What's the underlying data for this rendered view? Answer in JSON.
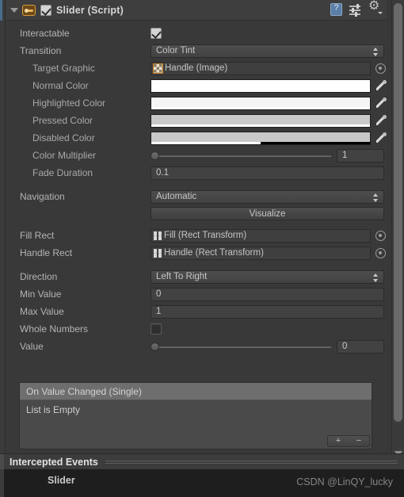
{
  "component": {
    "title": "Slider (Script)",
    "enabled_checkbox": "checked",
    "icons": {
      "foldout": "foldout-triangle-icon",
      "component": "slider-component-icon",
      "help": "help-book-icon",
      "preset": "preset-sliders-icon",
      "settings": "gear-dropdown-icon"
    }
  },
  "properties": {
    "interactable": {
      "label": "Interactable",
      "value": "checked"
    },
    "transition": {
      "label": "Transition",
      "value": "Color Tint"
    },
    "target_graphic": {
      "label": "Target Graphic",
      "value": "Handle (Image)"
    },
    "normal_color": {
      "label": "Normal Color",
      "hex": "#FFFFFF",
      "alpha": 100
    },
    "highlighted_color": {
      "label": "Highlighted Color",
      "hex": "#F5F5F5",
      "alpha": 100
    },
    "pressed_color": {
      "label": "Pressed Color",
      "hex": "#C8C8C8",
      "alpha": 100
    },
    "disabled_color": {
      "label": "Disabled Color",
      "hex": "#C8C8C8",
      "alpha": 50
    },
    "color_multiplier": {
      "label": "Color Multiplier",
      "value": "1",
      "slider_pct": 0
    },
    "fade_duration": {
      "label": "Fade Duration",
      "value": "0.1"
    },
    "navigation": {
      "label": "Navigation",
      "value": "Automatic"
    },
    "visualize": {
      "label": "Visualize"
    },
    "fill_rect": {
      "label": "Fill Rect",
      "value": "Fill (Rect Transform)"
    },
    "handle_rect": {
      "label": "Handle Rect",
      "value": "Handle (Rect Transform)"
    },
    "direction": {
      "label": "Direction",
      "value": "Left To Right"
    },
    "min_value": {
      "label": "Min Value",
      "value": "0"
    },
    "max_value": {
      "label": "Max Value",
      "value": "1"
    },
    "whole_numbers": {
      "label": "Whole Numbers",
      "value": "unchecked"
    },
    "value": {
      "label": "Value",
      "value": "0",
      "slider_pct": 0
    }
  },
  "events": {
    "header": "On Value Changed (Single)",
    "empty_text": "List is Empty",
    "add_label": "+",
    "remove_label": "−"
  },
  "intercepted": {
    "title": "Intercepted Events",
    "item": "Slider"
  },
  "watermark": "CSDN @LinQY_lucky"
}
